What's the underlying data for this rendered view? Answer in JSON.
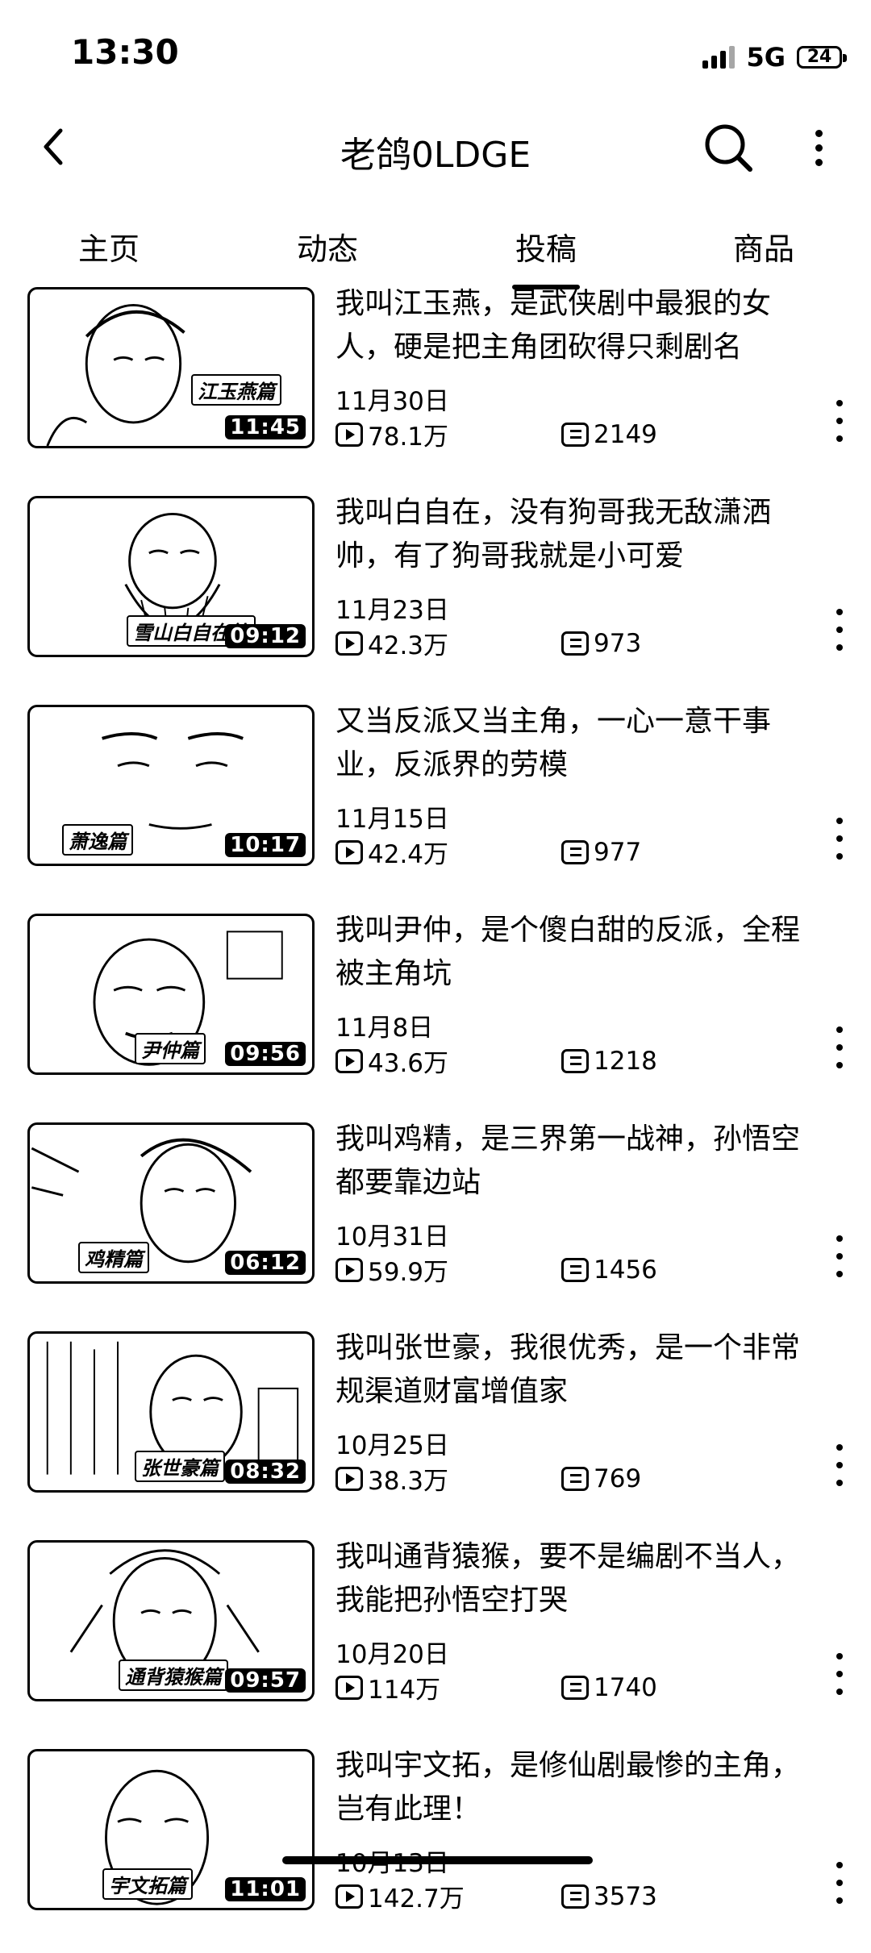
{
  "status": {
    "time": "13:30",
    "network": "5G",
    "battery": "24"
  },
  "header": {
    "title": "老鸽0LDGE"
  },
  "tabs": [
    {
      "label": "主页",
      "active": false
    },
    {
      "label": "动态",
      "active": false
    },
    {
      "label": "投稿",
      "active": true
    },
    {
      "label": "商品",
      "active": false
    }
  ],
  "videos": [
    {
      "title": "我叫江玉燕，是武侠剧中最狠的女人，硬是把主角团砍得只剩剧名",
      "date": "11月30日",
      "views": "78.1万",
      "comments": "2149",
      "duration": "11:45",
      "caption": "江玉燕篇"
    },
    {
      "title": "我叫白自在，没有狗哥我无敌潇洒帅，有了狗哥我就是小可爱",
      "date": "11月23日",
      "views": "42.3万",
      "comments": "973",
      "duration": "09:12",
      "caption": "雪山白自在篇"
    },
    {
      "title": "又当反派又当主角，一心一意干事业，反派界的劳模",
      "date": "11月15日",
      "views": "42.4万",
      "comments": "977",
      "duration": "10:17",
      "caption": "萧逸篇"
    },
    {
      "title": "我叫尹仲，是个傻白甜的反派，全程被主角坑",
      "date": "11月8日",
      "views": "43.6万",
      "comments": "1218",
      "duration": "09:56",
      "caption": "尹仲篇"
    },
    {
      "title": "我叫鸡精，是三界第一战神，孙悟空都要靠边站",
      "date": "10月31日",
      "views": "59.9万",
      "comments": "1456",
      "duration": "06:12",
      "caption": "鸡精篇"
    },
    {
      "title": "我叫张世豪，我很优秀，是一个非常规渠道财富增值家",
      "date": "10月25日",
      "views": "38.3万",
      "comments": "769",
      "duration": "08:32",
      "caption": "张世豪篇"
    },
    {
      "title": "我叫通背猿猴，要不是编剧不当人，我能把孙悟空打哭",
      "date": "10月20日",
      "views": "114万",
      "comments": "1740",
      "duration": "09:57",
      "caption": "通背猿猴篇"
    },
    {
      "title": "我叫宇文拓，是修仙剧最惨的主角，岂有此理！",
      "date": "10月13日",
      "views": "142.7万",
      "comments": "3573",
      "duration": "11:01",
      "caption": "宇文拓篇"
    }
  ]
}
